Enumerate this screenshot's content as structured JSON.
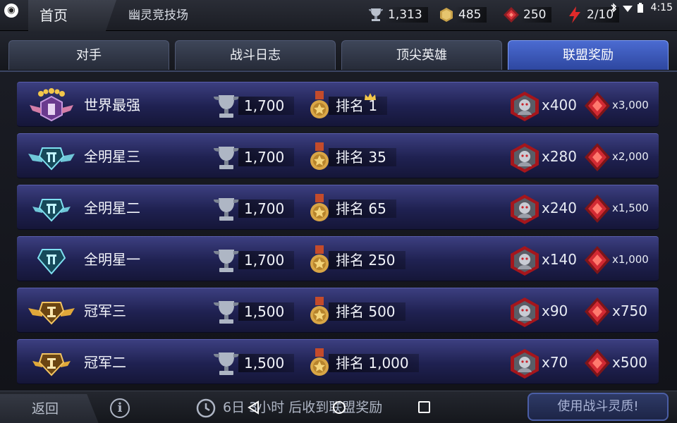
{
  "topbar": {
    "home_label": "首页",
    "title": "幽灵竞技场",
    "resources": {
      "trophies": "1,313",
      "gold": "485",
      "cubes": "250",
      "energy": "2/10"
    },
    "status_time": "4:15"
  },
  "tabs": [
    {
      "label": "对手",
      "active": false
    },
    {
      "label": "战斗日志",
      "active": false
    },
    {
      "label": "顶尖英雄",
      "active": false
    },
    {
      "label": "联盟奖励",
      "active": true
    }
  ],
  "rows": [
    {
      "tier": "世界最强",
      "badge": "purple-stars",
      "trophy": "1,700",
      "rank": "排名 1",
      "crown": true,
      "reward1": "x400",
      "reward2": "x3,000",
      "reward2_small": true
    },
    {
      "tier": "全明星三",
      "badge": "cyan-wings",
      "trophy": "1,700",
      "rank": "排名 35",
      "crown": false,
      "reward1": "x280",
      "reward2": "x2,000",
      "reward2_small": true
    },
    {
      "tier": "全明星二",
      "badge": "cyan-wings-small",
      "trophy": "1,700",
      "rank": "排名 65",
      "crown": false,
      "reward1": "x240",
      "reward2": "x1,500",
      "reward2_small": true
    },
    {
      "tier": "全明星一",
      "badge": "cyan-plain",
      "trophy": "1,700",
      "rank": "排名 250",
      "crown": false,
      "reward1": "x140",
      "reward2": "x1,000",
      "reward2_small": true
    },
    {
      "tier": "冠军三",
      "badge": "gold-wings",
      "trophy": "1,500",
      "rank": "排名 500",
      "crown": false,
      "reward1": "x90",
      "reward2": "x750",
      "reward2_small": false
    },
    {
      "tier": "冠军二",
      "badge": "gold-wings-small",
      "trophy": "1,500",
      "rank": "排名 1,000",
      "crown": false,
      "reward1": "x70",
      "reward2": "x500",
      "reward2_small": false
    }
  ],
  "bottombar": {
    "back_label": "返回",
    "info_label": "i",
    "timer_text": "6日 3小时 后收到联盟奖励",
    "use_button_label": "使用战斗灵质!"
  },
  "colors": {
    "accent_tab": "#3f5cc4",
    "row_bg": "#242660",
    "reward_red": "#c8232b"
  },
  "icons": [
    "trophy-icon",
    "gold-icon",
    "cube-icon",
    "energy-icon",
    "medal-icon",
    "crown-icon",
    "hero-crystal-icon",
    "red-cube-icon",
    "clock-icon",
    "info-icon"
  ]
}
